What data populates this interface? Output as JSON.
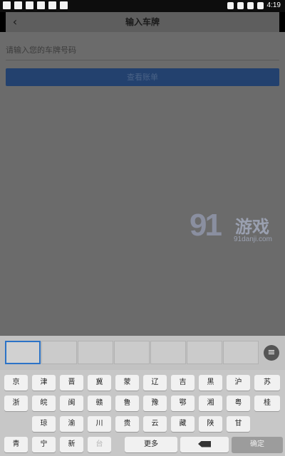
{
  "status_bar": {
    "time": "4:19"
  },
  "header": {
    "title": "输入车牌"
  },
  "plate_input": {
    "placeholder": "请输入您的车牌号码"
  },
  "view_bill_button": {
    "label": "查看账单"
  },
  "watermark": {
    "number": "91",
    "text": "游戏",
    "url": "91danji.com"
  },
  "keyboard": {
    "row1": [
      "京",
      "津",
      "晋",
      "冀",
      "蒙",
      "辽",
      "吉",
      "黑",
      "沪",
      "苏"
    ],
    "row2": [
      "浙",
      "皖",
      "闽",
      "赣",
      "鲁",
      "豫",
      "鄂",
      "湘",
      "粤",
      "桂"
    ],
    "row3": [
      "琼",
      "渝",
      "川",
      "贵",
      "云",
      "藏",
      "陕",
      "甘"
    ],
    "row4": [
      "青",
      "宁",
      "新",
      "台"
    ],
    "more_label": "更多",
    "confirm_label": "确定",
    "delete_icon": "backspace-icon"
  }
}
